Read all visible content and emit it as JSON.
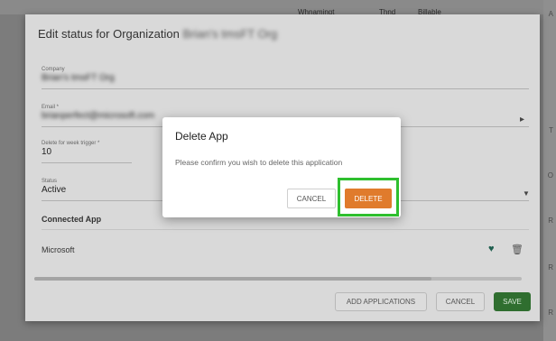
{
  "background": {
    "columns": [
      "Whnamingt",
      "Thnd",
      "Billable"
    ],
    "right_marks": [
      "A",
      "T",
      "O",
      "R",
      "R",
      "R"
    ]
  },
  "edit_dialog": {
    "title_prefix": "Edit status for Organization",
    "org_name": "Brian's tmsFT Org",
    "fields": {
      "company": {
        "label": "Company",
        "value": "Brian's tmsFT Org"
      },
      "email": {
        "label": "Email *",
        "value": "brianperfect@microsoft.com"
      },
      "days": {
        "label": "Delete for week trigger *",
        "value": "10"
      },
      "status": {
        "label": "Status",
        "value": "Active"
      }
    },
    "connected_header": "Connected App",
    "connected_apps": [
      {
        "name": "Microsoft"
      }
    ],
    "footer": {
      "add_applications": "ADD APPLICATIONS",
      "cancel": "CANCEL",
      "save": "SAVE"
    }
  },
  "confirm_modal": {
    "title": "Delete App",
    "message": "Please confirm you wish to delete this application",
    "cancel": "CANCEL",
    "delete": "DELETE"
  },
  "colors": {
    "delete_button": "#e07b2c",
    "highlight": "#2fbf2f",
    "save_button": "#2f6e2f"
  }
}
